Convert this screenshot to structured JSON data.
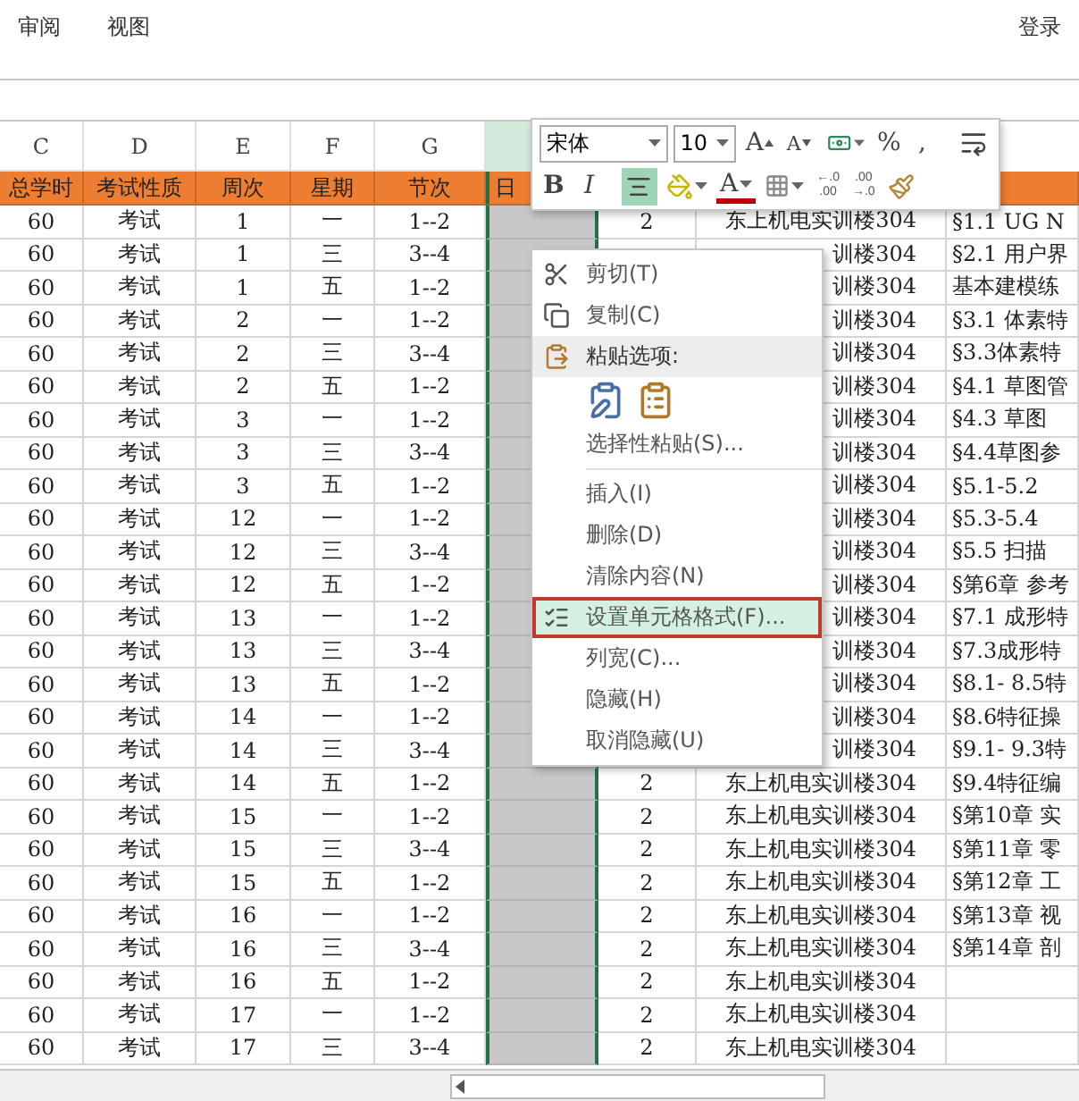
{
  "menu": {
    "tabs": [
      {
        "label": "审阅"
      },
      {
        "label": "视图"
      }
    ],
    "login": "登录"
  },
  "columns": [
    "C",
    "D",
    "E",
    "F",
    "G"
  ],
  "header": [
    "总学时",
    "考试性质",
    "周次",
    "星期",
    "节次",
    "日"
  ],
  "rows": [
    {
      "cells": [
        "60",
        "考试",
        "1",
        "一",
        "1--2"
      ],
      "col_i": "2",
      "col_j": "东上机电实训楼304",
      "col_k": "§1.1  UG N"
    },
    {
      "cells": [
        "60",
        "考试",
        "1",
        "三",
        "3--4"
      ],
      "col_j": "训楼304",
      "col_k": "§2.1 用户界"
    },
    {
      "cells": [
        "60",
        "考试",
        "1",
        "五",
        "1--2"
      ],
      "col_j": "训楼304",
      "col_k": "基本建模练"
    },
    {
      "cells": [
        "60",
        "考试",
        "2",
        "一",
        "1--2"
      ],
      "col_j": "训楼304",
      "col_k": "§3.1 体素特"
    },
    {
      "cells": [
        "60",
        "考试",
        "2",
        "三",
        "3--4"
      ],
      "col_j": "训楼304",
      "col_k": "§3.3体素特"
    },
    {
      "cells": [
        "60",
        "考试",
        "2",
        "五",
        "1--2"
      ],
      "col_j": "训楼304",
      "col_k": "§4.1 草图管"
    },
    {
      "cells": [
        "60",
        "考试",
        "3",
        "一",
        "1--2"
      ],
      "col_j": "训楼304",
      "col_k": "§4.3 草图"
    },
    {
      "cells": [
        "60",
        "考试",
        "3",
        "三",
        "3--4"
      ],
      "col_j": "训楼304",
      "col_k": "§4.4草图参"
    },
    {
      "cells": [
        "60",
        "考试",
        "3",
        "五",
        "1--2"
      ],
      "col_j": "训楼304",
      "col_k": "§5.1-5.2"
    },
    {
      "cells": [
        "60",
        "考试",
        "12",
        "一",
        "1--2"
      ],
      "col_j": "训楼304",
      "col_k": "§5.3-5.4"
    },
    {
      "cells": [
        "60",
        "考试",
        "12",
        "三",
        "3--4"
      ],
      "col_j": "训楼304",
      "col_k": "§5.5  扫描"
    },
    {
      "cells": [
        "60",
        "考试",
        "12",
        "五",
        "1--2"
      ],
      "col_j": "训楼304",
      "col_k": "§第6章 参考"
    },
    {
      "cells": [
        "60",
        "考试",
        "13",
        "一",
        "1--2"
      ],
      "col_j": "训楼304",
      "col_k": "§7.1 成形特"
    },
    {
      "cells": [
        "60",
        "考试",
        "13",
        "三",
        "3--4"
      ],
      "col_j": "训楼304",
      "col_k": "§7.3成形特"
    },
    {
      "cells": [
        "60",
        "考试",
        "13",
        "五",
        "1--2"
      ],
      "col_j": "训楼304",
      "col_k": "§8.1- 8.5特"
    },
    {
      "cells": [
        "60",
        "考试",
        "14",
        "一",
        "1--2"
      ],
      "col_j": "训楼304",
      "col_k": "§8.6特征操"
    },
    {
      "cells": [
        "60",
        "考试",
        "14",
        "三",
        "3--4"
      ],
      "col_j": "训楼304",
      "col_k": "§9.1- 9.3特"
    },
    {
      "cells": [
        "60",
        "考试",
        "14",
        "五",
        "1--2"
      ],
      "col_i": "2",
      "col_j": "东上机电实训楼304",
      "col_k": "§9.4特征编"
    },
    {
      "cells": [
        "60",
        "考试",
        "15",
        "一",
        "1--2"
      ],
      "col_i": "2",
      "col_j": "东上机电实训楼304",
      "col_k": "§第10章 实"
    },
    {
      "cells": [
        "60",
        "考试",
        "15",
        "三",
        "3--4"
      ],
      "col_i": "2",
      "col_j": "东上机电实训楼304",
      "col_k": "§第11章 零"
    },
    {
      "cells": [
        "60",
        "考试",
        "15",
        "五",
        "1--2"
      ],
      "col_i": "2",
      "col_j": "东上机电实训楼304",
      "col_k": "§第12章 工"
    },
    {
      "cells": [
        "60",
        "考试",
        "16",
        "一",
        "1--2"
      ],
      "col_i": "2",
      "col_j": "东上机电实训楼304",
      "col_k": "§第13章 视"
    },
    {
      "cells": [
        "60",
        "考试",
        "16",
        "三",
        "3--4"
      ],
      "col_i": "2",
      "col_j": "东上机电实训楼304",
      "col_k": "§第14章 剖"
    },
    {
      "cells": [
        "60",
        "考试",
        "16",
        "五",
        "1--2"
      ],
      "col_i": "2",
      "col_j": "东上机电实训楼304"
    },
    {
      "cells": [
        "60",
        "考试",
        "17",
        "一",
        "1--2"
      ],
      "col_i": "2",
      "col_j": "东上机电实训楼304"
    },
    {
      "cells": [
        "60",
        "考试",
        "17",
        "三",
        "3--4"
      ],
      "col_i": "2",
      "col_j": "东上机电实训楼304"
    }
  ],
  "mini_toolbar": {
    "font": "宋体",
    "size": "10",
    "tools": [
      {
        "kind": "grow",
        "label": "A"
      },
      {
        "kind": "shrink",
        "label": "A"
      },
      {
        "kind": "accounting"
      },
      {
        "kind": "text",
        "label": "%"
      },
      {
        "kind": "text",
        "label": ","
      },
      {
        "kind": "wrap"
      }
    ],
    "format_tools": [
      {
        "kind": "bold",
        "label": "B",
        "selected": false
      },
      {
        "kind": "italic",
        "label": "I",
        "selected": false
      },
      {
        "kind": "align",
        "selected": true
      },
      {
        "kind": "fill",
        "selected": false
      },
      {
        "kind": "fontcolor",
        "label": "A",
        "selected": false
      },
      {
        "kind": "border",
        "selected": false
      },
      {
        "kind": "decimal",
        "lines": [
          "←.0",
          ".00"
        ],
        "selected": false
      },
      {
        "kind": "decimal",
        "lines": [
          ".00",
          "→.0"
        ],
        "selected": false
      },
      {
        "kind": "painter",
        "selected": false
      }
    ]
  },
  "context_menu": [
    {
      "kind": "cut",
      "label": "剪切(T)",
      "selected": false
    },
    {
      "kind": "copy",
      "label": "复制(C)",
      "selected": false
    },
    {
      "kind": "paste_header",
      "label": "粘贴选项:"
    },
    {
      "kind": "paste_icons"
    },
    {
      "kind": "item",
      "label": "选择性粘贴(S)...",
      "selected": false
    },
    {
      "kind": "separator"
    },
    {
      "kind": "item",
      "label": "插入(I)",
      "selected": false
    },
    {
      "kind": "item",
      "label": "删除(D)",
      "selected": false
    },
    {
      "kind": "item",
      "label": "清除内容(N)",
      "selected": false
    },
    {
      "kind": "format",
      "label": "设置单元格格式(F)...",
      "selected": true
    },
    {
      "kind": "item",
      "label": "列宽(C)...",
      "selected": false
    },
    {
      "kind": "item",
      "label": "隐藏(H)",
      "selected": false
    },
    {
      "kind": "item",
      "label": "取消隐藏(U)",
      "selected": false
    }
  ]
}
